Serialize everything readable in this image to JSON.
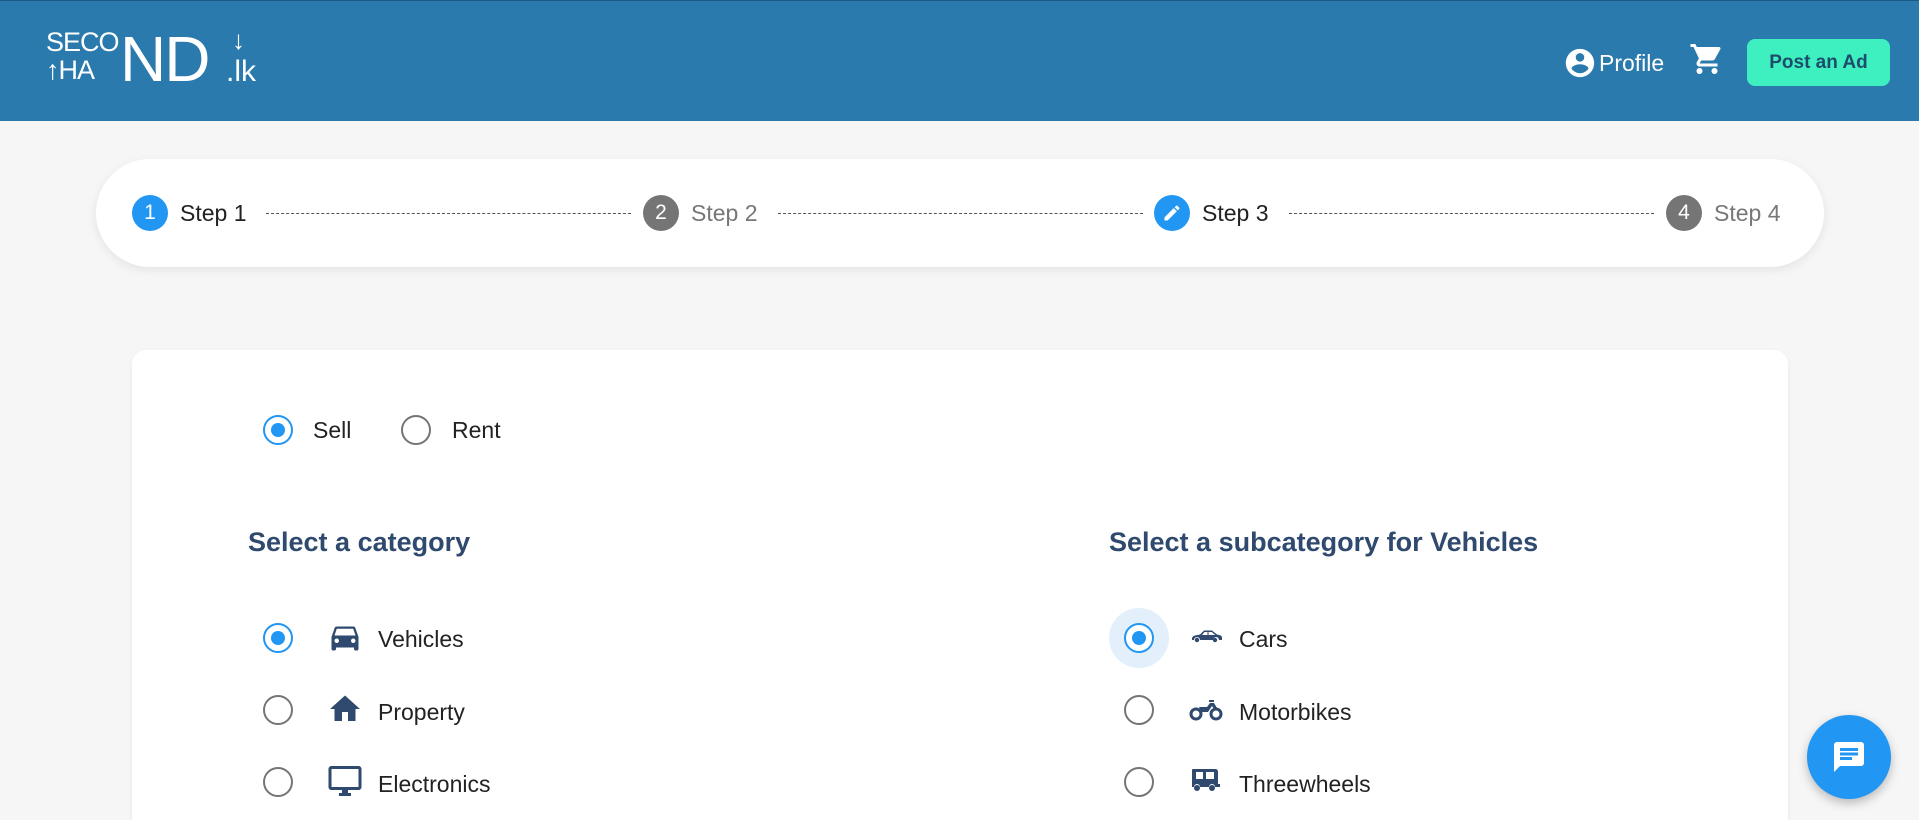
{
  "header": {
    "logo": {
      "line1": "SECO",
      "line2": "HA",
      "big": "ND",
      "suffix": ".lk"
    },
    "profile_label": "Profile",
    "post_ad_label": "Post an Ad",
    "colors": {
      "background": "#2b7aad",
      "post_button": "#3ef0c0"
    }
  },
  "stepper": {
    "steps": [
      {
        "number": "1",
        "label": "Step 1",
        "state": "active"
      },
      {
        "number": "2",
        "label": "Step 2",
        "state": "inactive"
      },
      {
        "number": "",
        "label": "Step 3",
        "state": "editing",
        "icon": "pencil-icon"
      },
      {
        "number": "4",
        "label": "Step 4",
        "state": "inactive"
      }
    ]
  },
  "listing_type": {
    "options": [
      {
        "label": "Sell",
        "checked": true
      },
      {
        "label": "Rent",
        "checked": false
      }
    ]
  },
  "category": {
    "title": "Select a category",
    "options": [
      {
        "label": "Vehicles",
        "icon": "car-icon",
        "checked": true
      },
      {
        "label": "Property",
        "icon": "house-icon",
        "checked": false
      },
      {
        "label": "Electronics",
        "icon": "monitor-icon",
        "checked": false
      }
    ]
  },
  "subcategory": {
    "title": "Select a subcategory for Vehicles",
    "options": [
      {
        "label": "Cars",
        "icon": "car-side-icon",
        "checked": true
      },
      {
        "label": "Motorbikes",
        "icon": "motorbike-icon",
        "checked": false
      },
      {
        "label": "Threewheels",
        "icon": "threewheeler-icon",
        "checked": false
      }
    ]
  },
  "fab": {
    "icon": "chat-icon"
  },
  "accent_color": "#2196f3",
  "title_color": "#2f4a6e"
}
